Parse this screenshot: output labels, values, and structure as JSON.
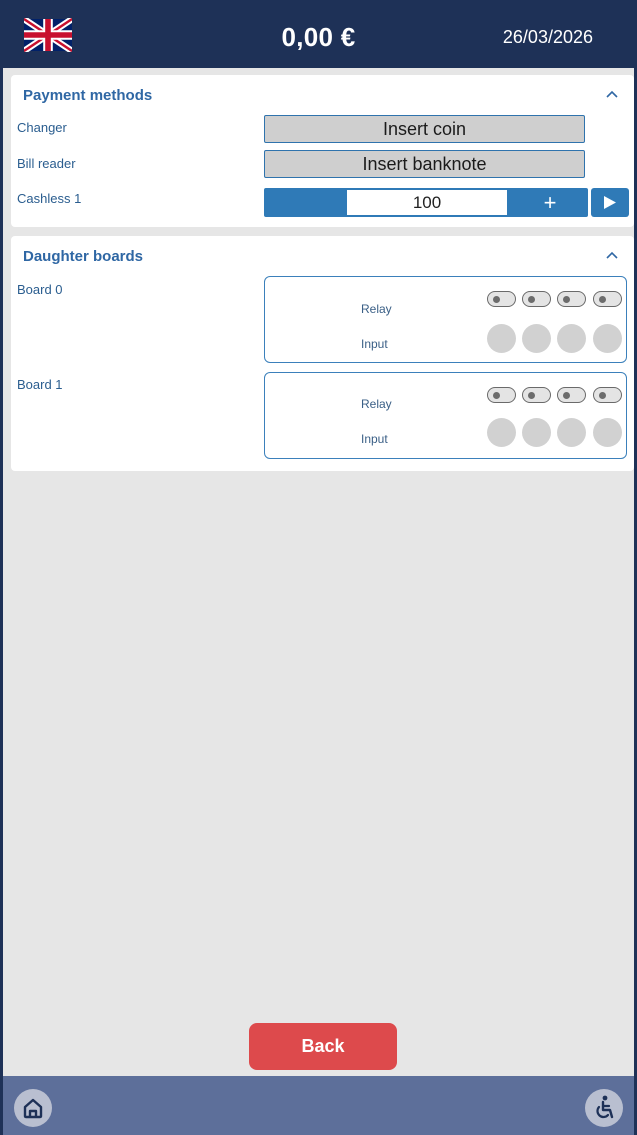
{
  "header": {
    "flag_icon": "uk-flag-icon",
    "amount": "0,00 €",
    "date": "26/03/2026"
  },
  "payment_methods": {
    "title": "Payment methods",
    "collapse_icon": "chevron-up-icon",
    "changer": {
      "label": "Changer",
      "button": "Insert coin"
    },
    "bill_reader": {
      "label": "Bill reader",
      "button": "Insert banknote"
    },
    "cashless": {
      "label": "Cashless 1",
      "value": "100",
      "plus": "+",
      "submit_icon": "play-icon"
    }
  },
  "daughter_boards": {
    "title": "Daughter boards",
    "collapse_icon": "chevron-up-icon",
    "boards": [
      {
        "label": "Board 0",
        "relay_label": "Relay",
        "input_label": "Input",
        "relays": 4,
        "inputs": 4
      },
      {
        "label": "Board 1",
        "relay_label": "Relay",
        "input_label": "Input",
        "relays": 4,
        "inputs": 4
      }
    ]
  },
  "footer": {
    "back_label": "Back",
    "home_icon": "home-icon",
    "accessibility_icon": "wheelchair-icon"
  },
  "colors": {
    "header_bg": "#1e3157",
    "accent_blue": "#2f7ab7",
    "back_red": "#dd4a4c",
    "bottom_bar": "#5d6f9a"
  }
}
